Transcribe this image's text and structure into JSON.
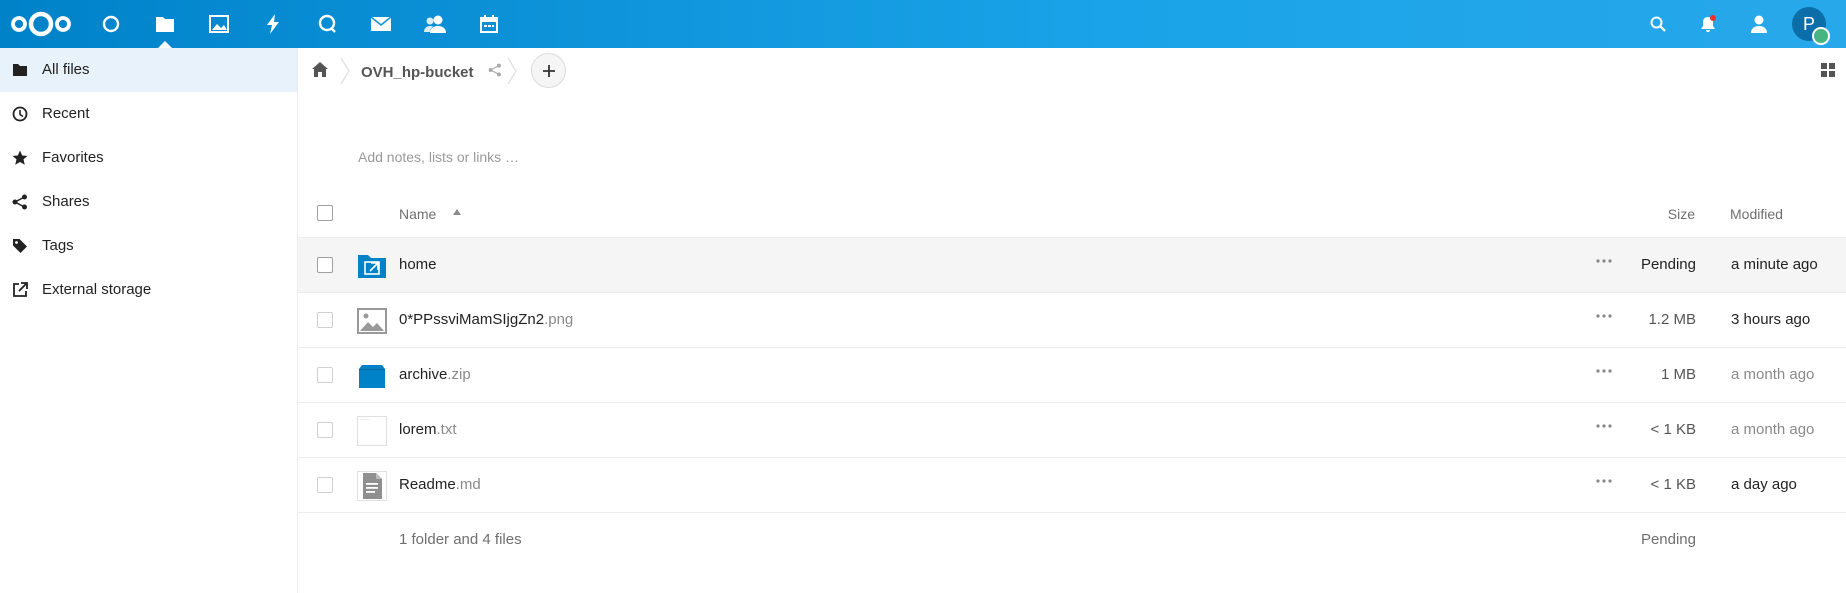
{
  "header": {
    "apps": [
      {
        "name": "dashboard-icon"
      },
      {
        "name": "files-icon"
      },
      {
        "name": "photos-icon"
      },
      {
        "name": "activity-icon"
      },
      {
        "name": "talk-icon"
      },
      {
        "name": "mail-icon"
      },
      {
        "name": "contacts-icon"
      },
      {
        "name": "calendar-icon"
      }
    ],
    "active_app": "files-icon",
    "right_icons": [
      "search-icon",
      "notifications-icon",
      "contacts-menu-icon"
    ],
    "avatar_letter": "P",
    "colors": {
      "bar_start": "#0082c9",
      "bar_end": "#27a8ea",
      "status_online": "#49b382",
      "notification_dot": "#e9322d"
    }
  },
  "sidebar": {
    "items": [
      {
        "label": "All files",
        "icon": "folder-icon",
        "active": true
      },
      {
        "label": "Recent",
        "icon": "clock-icon",
        "active": false
      },
      {
        "label": "Favorites",
        "icon": "star-icon",
        "active": false
      },
      {
        "label": "Shares",
        "icon": "share-icon",
        "active": false
      },
      {
        "label": "Tags",
        "icon": "tag-icon",
        "active": false
      },
      {
        "label": "External storage",
        "icon": "external-icon",
        "active": false
      }
    ]
  },
  "breadcrumb": {
    "folder": "OVH_hp-bucket"
  },
  "notes": {
    "placeholder": "Add notes, lists or links …"
  },
  "table": {
    "headers": {
      "name": "Name",
      "size": "Size",
      "modified": "Modified"
    },
    "rows": [
      {
        "name": "home",
        "ext": "",
        "icon": "external-folder-icon",
        "size": "Pending",
        "modified": "a minute ago"
      },
      {
        "name": "0*PPssviMamSIjgZn2",
        "ext": ".png",
        "icon": "image-icon",
        "size": "1.2 MB",
        "modified": "3 hours ago"
      },
      {
        "name": "archive",
        "ext": ".zip",
        "icon": "archive-icon",
        "size": "1 MB",
        "modified": "a month ago"
      },
      {
        "name": "lorem",
        "ext": ".txt",
        "icon": "text-file-icon",
        "size": "< 1 KB",
        "modified": "a month ago"
      },
      {
        "name": "Readme",
        "ext": ".md",
        "icon": "document-icon",
        "size": "< 1 KB",
        "modified": "a day ago"
      }
    ],
    "summary": {
      "text": "1 folder and 4 files",
      "size": "Pending"
    }
  }
}
